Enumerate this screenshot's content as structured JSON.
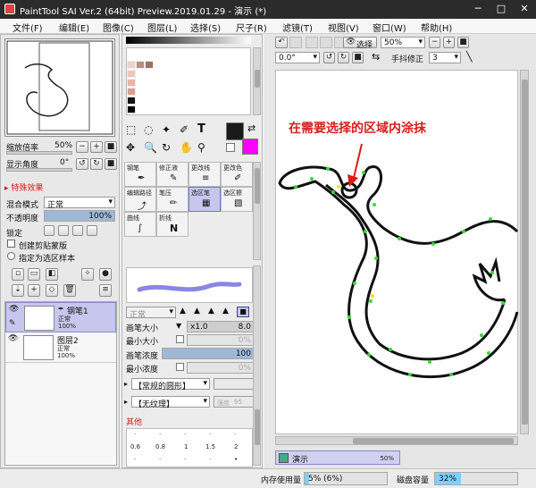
{
  "window": {
    "title": "PaintTool SAI Ver.2 (64bit) Preview.2019.01.29 - 演示 (*)",
    "min": "─",
    "max": "□",
    "close": "✕"
  },
  "menu": [
    "文件(F)",
    "编辑(E)",
    "图像(C)",
    "图层(L)",
    "选择(S)",
    "尺子(R)",
    "滤镜(T)",
    "视图(V)",
    "窗口(W)",
    "帮助(H)"
  ],
  "navigator": {
    "zoom_label": "缩放倍率",
    "zoom_value": "50%",
    "angle_label": "显示角度",
    "angle_value": "0°"
  },
  "layer_panel": {
    "section": "▸ 特殊效果",
    "blend_label": "混合模式",
    "blend_value": "正常",
    "opacity_label": "不透明度",
    "opacity_value": "100%",
    "opacity_fill": 1.0,
    "lock_label": "锁定",
    "clip_label": "创建剪贴蒙版",
    "sample_label": "指定为选区样本",
    "layers": [
      {
        "name": "钢笔1",
        "mode": "正常",
        "opacity": "100%"
      },
      {
        "name": "图层2",
        "mode": "正常",
        "opacity": "100%"
      }
    ]
  },
  "colors": {
    "primary": "#1a1a1a",
    "secondary": "#ff00ff",
    "accent": "#d81e1e"
  },
  "tools": [
    {
      "name": "钢笔",
      "icon": "pen-icon"
    },
    {
      "name": "修正液",
      "icon": "correction-icon"
    },
    {
      "name": "更改线",
      "icon": "line-edit-icon"
    },
    {
      "name": "更改色",
      "icon": "color-edit-icon"
    },
    {
      "name": "编辑路径",
      "icon": "path-edit-icon"
    },
    {
      "name": "笔压",
      "icon": "pressure-icon"
    },
    {
      "name": "选区笔",
      "icon": "selection-pen-icon"
    },
    {
      "name": "选区擦",
      "icon": "selection-eraser-icon"
    },
    {
      "name": "曲线",
      "icon": "curve-icon"
    },
    {
      "name": "折线",
      "icon": "polyline-icon"
    }
  ],
  "brush": {
    "mode": "正常",
    "size_label": "画笔大小",
    "size_mult": "x1.0",
    "size_value": "8.0",
    "min_size_label": "最小大小",
    "min_size_value": "0%",
    "density_label": "画笔浓度",
    "density_value": "100",
    "density_fill": 1.0,
    "min_density_label": "最小浓度",
    "min_density_value": "0%",
    "shape": "【常规的圆形】",
    "texture": "【无纹理】",
    "texture_strength": "强度",
    "texture_value": "95",
    "other": "其他",
    "tip_sizes": [
      "0.6",
      "0.8",
      "1",
      "1.5",
      "2"
    ]
  },
  "canvas_toolbar": {
    "select_label": "选择",
    "zoom": "50%",
    "angle": "0.0°",
    "stabilizer_label": "手抖修正",
    "stabilizer_value": "3"
  },
  "canvas": {
    "annotation": "在需要选择的区域内涂抹"
  },
  "status": {
    "doc_name": "演示",
    "doc_zoom": "50%",
    "mem_label": "内存使用量",
    "mem_value": "5% (6%)",
    "mem_fill": 0.05,
    "disk_label": "磁盘容量",
    "disk_value": "32%",
    "disk_fill": 0.32
  }
}
